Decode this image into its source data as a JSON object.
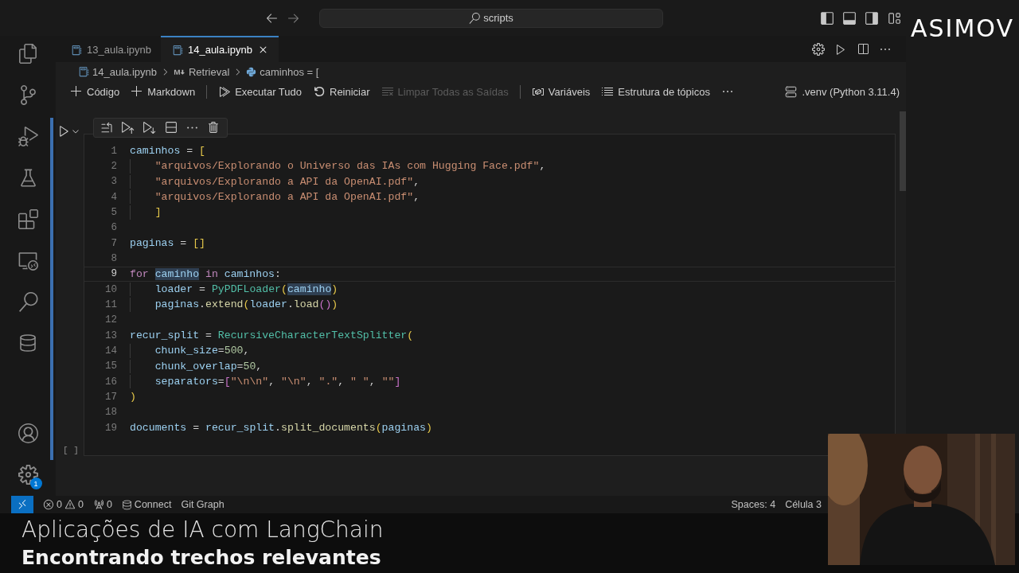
{
  "title_bar": {
    "search": "scripts"
  },
  "logo": "ASIMOV",
  "activity_bar": {
    "settings_badge": "1"
  },
  "tabs": [
    {
      "label": "13_aula.ipynb",
      "selected": false
    },
    {
      "label": "14_aula.ipynb",
      "selected": true
    }
  ],
  "breadcrumbs": [
    "14_aula.ipynb",
    "Retrieval",
    "caminhos = ["
  ],
  "toolbar": [
    {
      "label": "Código",
      "disabled": false
    },
    {
      "label": "Markdown",
      "disabled": false
    },
    {
      "label": "Executar Tudo",
      "disabled": false
    },
    {
      "label": "Reiniciar",
      "disabled": false
    },
    {
      "label": "Limpar Todas as Saídas",
      "disabled": true
    },
    {
      "label": "Variáveis",
      "disabled": false
    },
    {
      "label": "Estrutura de tópicos",
      "disabled": false
    }
  ],
  "kernel": ".venv (Python 3.11.4)",
  "cell": {
    "execution_count": "[ ]",
    "lines": [
      {
        "number": "1",
        "current": false,
        "indented": false,
        "tokens": [
          {
            "kind": "v",
            "text": "caminhos"
          },
          {
            "kind": "o",
            "text": " = "
          },
          {
            "kind": "b1",
            "text": "["
          }
        ]
      },
      {
        "number": "2",
        "current": false,
        "indented": true,
        "tokens": [
          {
            "kind": "s",
            "text": "\"arquivos/Explorando o Universo das IAs com Hugging Face.pdf\""
          },
          {
            "kind": "o",
            "text": ","
          }
        ]
      },
      {
        "number": "3",
        "current": false,
        "indented": true,
        "tokens": [
          {
            "kind": "s",
            "text": "\"arquivos/Explorando a API da OpenAI.pdf\""
          },
          {
            "kind": "o",
            "text": ","
          }
        ]
      },
      {
        "number": "4",
        "current": false,
        "indented": true,
        "tokens": [
          {
            "kind": "s",
            "text": "\"arquivos/Explorando a API da OpenAI.pdf\""
          },
          {
            "kind": "o",
            "text": ","
          }
        ]
      },
      {
        "number": "5",
        "current": false,
        "indented": true,
        "tokens": [
          {
            "kind": "b1",
            "text": "]"
          }
        ]
      },
      {
        "number": "6",
        "current": false,
        "indented": false
      },
      {
        "number": "7",
        "current": false,
        "indented": false,
        "tokens": [
          {
            "kind": "v",
            "text": "paginas"
          },
          {
            "kind": "o",
            "text": " = "
          },
          {
            "kind": "b1",
            "text": "[]"
          }
        ]
      },
      {
        "number": "8",
        "current": false,
        "indented": false
      },
      {
        "number": "9",
        "current": true,
        "indented": false,
        "tokens": [
          {
            "kind": "k",
            "text": "for "
          },
          {
            "kind": "m",
            "text": "caminho"
          },
          {
            "kind": "k",
            "text": " in "
          },
          {
            "kind": "v",
            "text": "caminhos"
          },
          {
            "kind": "o",
            "text": ":"
          }
        ]
      },
      {
        "number": "10",
        "current": false,
        "indented": true,
        "tokens": [
          {
            "kind": "v",
            "text": "loader"
          },
          {
            "kind": "o",
            "text": " = "
          },
          {
            "kind": "f",
            "text": "PyPDFLoader"
          },
          {
            "kind": "b1",
            "text": "("
          },
          {
            "kind": "m",
            "text": "caminho"
          },
          {
            "kind": "b1",
            "text": ")"
          }
        ]
      },
      {
        "number": "11",
        "current": false,
        "indented": true,
        "tokens": [
          {
            "kind": "v",
            "text": "paginas"
          },
          {
            "kind": "o",
            "text": "."
          },
          {
            "kind": "fn",
            "text": "extend"
          },
          {
            "kind": "b1",
            "text": "("
          },
          {
            "kind": "v",
            "text": "loader"
          },
          {
            "kind": "o",
            "text": "."
          },
          {
            "kind": "fn",
            "text": "load"
          },
          {
            "kind": "b2",
            "text": "()"
          },
          {
            "kind": "b1",
            "text": ")"
          }
        ]
      },
      {
        "number": "12",
        "current": false,
        "indented": false
      },
      {
        "number": "13",
        "current": false,
        "indented": false,
        "tokens": [
          {
            "kind": "v",
            "text": "recur_split"
          },
          {
            "kind": "o",
            "text": " = "
          },
          {
            "kind": "f",
            "text": "RecursiveCharacterTextSplitter"
          },
          {
            "kind": "b1",
            "text": "("
          }
        ]
      },
      {
        "number": "14",
        "current": false,
        "indented": true,
        "tokens": [
          {
            "kind": "v",
            "text": "chunk_size"
          },
          {
            "kind": "o",
            "text": "="
          },
          {
            "kind": "n",
            "text": "500"
          },
          {
            "kind": "o",
            "text": ","
          }
        ]
      },
      {
        "number": "15",
        "current": false,
        "indented": true,
        "tokens": [
          {
            "kind": "v",
            "text": "chunk_overlap"
          },
          {
            "kind": "o",
            "text": "="
          },
          {
            "kind": "n",
            "text": "50"
          },
          {
            "kind": "o",
            "text": ","
          }
        ]
      },
      {
        "number": "16",
        "current": false,
        "indented": true,
        "tokens": [
          {
            "kind": "v",
            "text": "separators"
          },
          {
            "kind": "o",
            "text": "="
          },
          {
            "kind": "b2",
            "text": "["
          },
          {
            "kind": "s",
            "text": "\"\\n\\n\""
          },
          {
            "kind": "o",
            "text": ", "
          },
          {
            "kind": "s",
            "text": "\"\\n\""
          },
          {
            "kind": "o",
            "text": ", "
          },
          {
            "kind": "s",
            "text": "\".\""
          },
          {
            "kind": "o",
            "text": ", "
          },
          {
            "kind": "s",
            "text": "\" \""
          },
          {
            "kind": "o",
            "text": ", "
          },
          {
            "kind": "s",
            "text": "\"\""
          },
          {
            "kind": "b2",
            "text": "]"
          }
        ]
      },
      {
        "number": "17",
        "current": false,
        "indented": false,
        "tokens": [
          {
            "kind": "b1",
            "text": ")"
          }
        ]
      },
      {
        "number": "18",
        "current": false,
        "indented": false
      },
      {
        "number": "19",
        "current": false,
        "indented": false,
        "tokens": [
          {
            "kind": "v",
            "text": "documents"
          },
          {
            "kind": "o",
            "text": " = "
          },
          {
            "kind": "v",
            "text": "recur_split"
          },
          {
            "kind": "o",
            "text": "."
          },
          {
            "kind": "fn",
            "text": "split_documents"
          },
          {
            "kind": "b1",
            "text": "("
          },
          {
            "kind": "v",
            "text": "paginas"
          },
          {
            "kind": "b1",
            "text": ")"
          }
        ]
      }
    ]
  },
  "status_bar": {
    "errors": "0",
    "warnings": "0",
    "ports": "0",
    "left": [
      "Connect",
      "Git Graph"
    ],
    "right": [
      "Spaces: 4",
      "Célula 3"
    ]
  },
  "caption": {
    "title": "Aplicações de IA com LangChain",
    "subtitle": "Encontrando trechos relevantes"
  },
  "webcam": {
    "kind": "picture"
  }
}
